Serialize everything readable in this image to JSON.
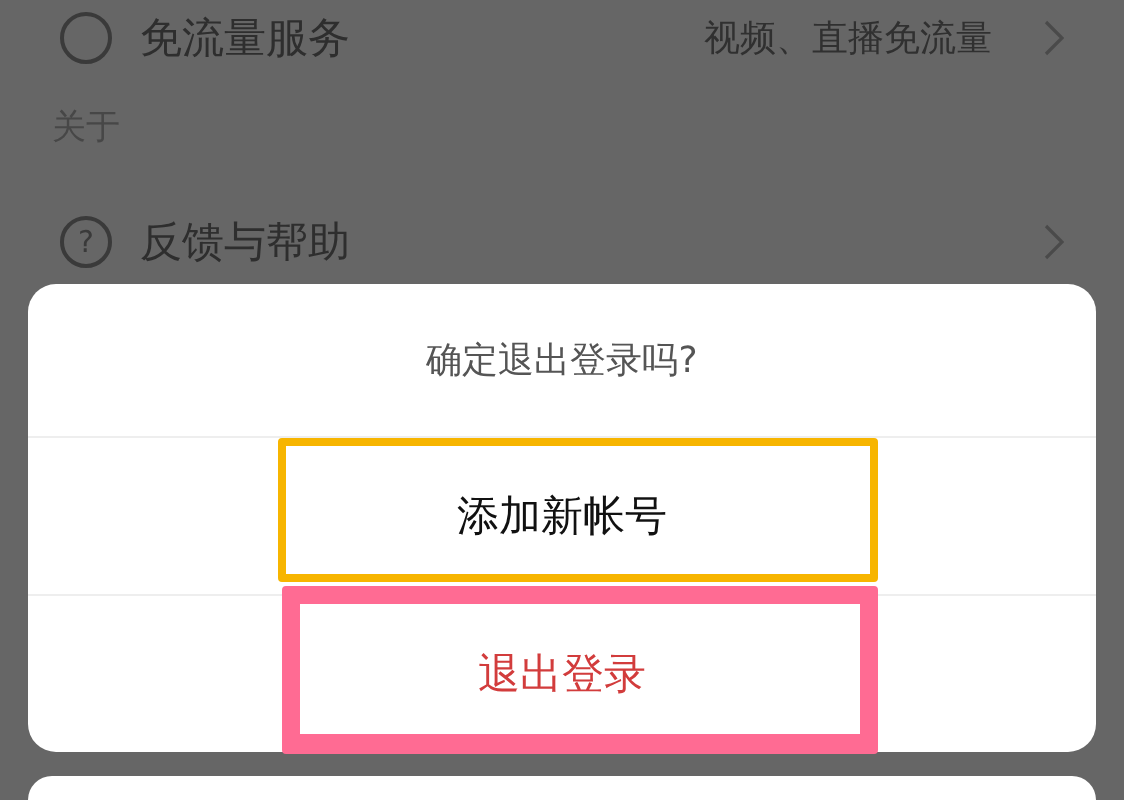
{
  "settings": [
    {
      "kind": "row",
      "label": "免流量服务",
      "detail": "视频、直播免流量"
    },
    {
      "kind": "header",
      "label": "关于"
    },
    {
      "kind": "row",
      "icon": "?",
      "label": "反馈与帮助"
    }
  ],
  "sheet": {
    "title": "确定退出登录吗?",
    "options": [
      {
        "label": "添加新帐号",
        "kind": "normal",
        "color": "#f7b500"
      },
      {
        "label": "退出登录",
        "kind": "destructive",
        "color": "#ff6b93"
      }
    ]
  }
}
